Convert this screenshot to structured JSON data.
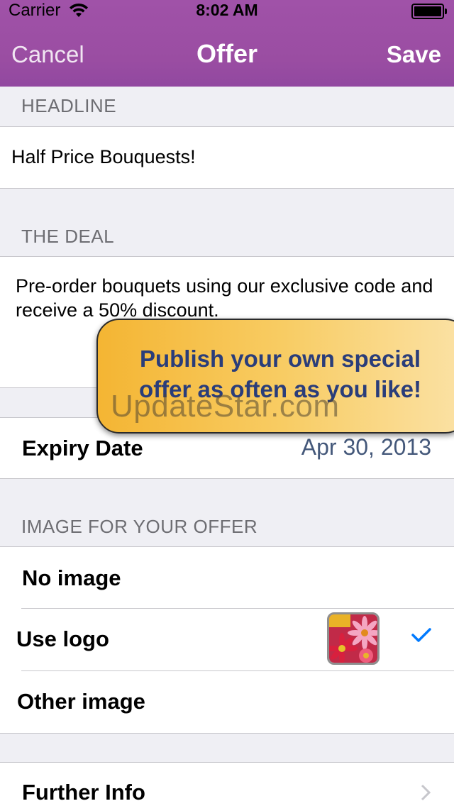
{
  "status_bar": {
    "carrier": "Carrier",
    "time": "8:02 AM"
  },
  "nav": {
    "cancel": "Cancel",
    "title": "Offer",
    "save": "Save"
  },
  "headline": {
    "header": "HEADLINE",
    "value": "Half Price Bouquests!"
  },
  "deal": {
    "header": "THE DEAL",
    "value": "Pre-order bouquets using our exclusive code and receive a 50% discount."
  },
  "expiry": {
    "label": "Expiry Date",
    "value": "Apr 30, 2013"
  },
  "image_section": {
    "header": "IMAGE FOR YOUR OFFER",
    "options": [
      "No image",
      "Use logo",
      "Other image"
    ],
    "selected": "Use logo"
  },
  "further_info": {
    "label": "Further Info"
  },
  "promo": {
    "line1": "Publish your own special",
    "line2": "offer as often as you like!"
  },
  "watermark": "UpdateStar.com",
  "colors": {
    "nav_bar": "#9b4fa3",
    "accent": "#007aff",
    "date_value": "#44587a",
    "callout_text": "#2a3d7a"
  }
}
